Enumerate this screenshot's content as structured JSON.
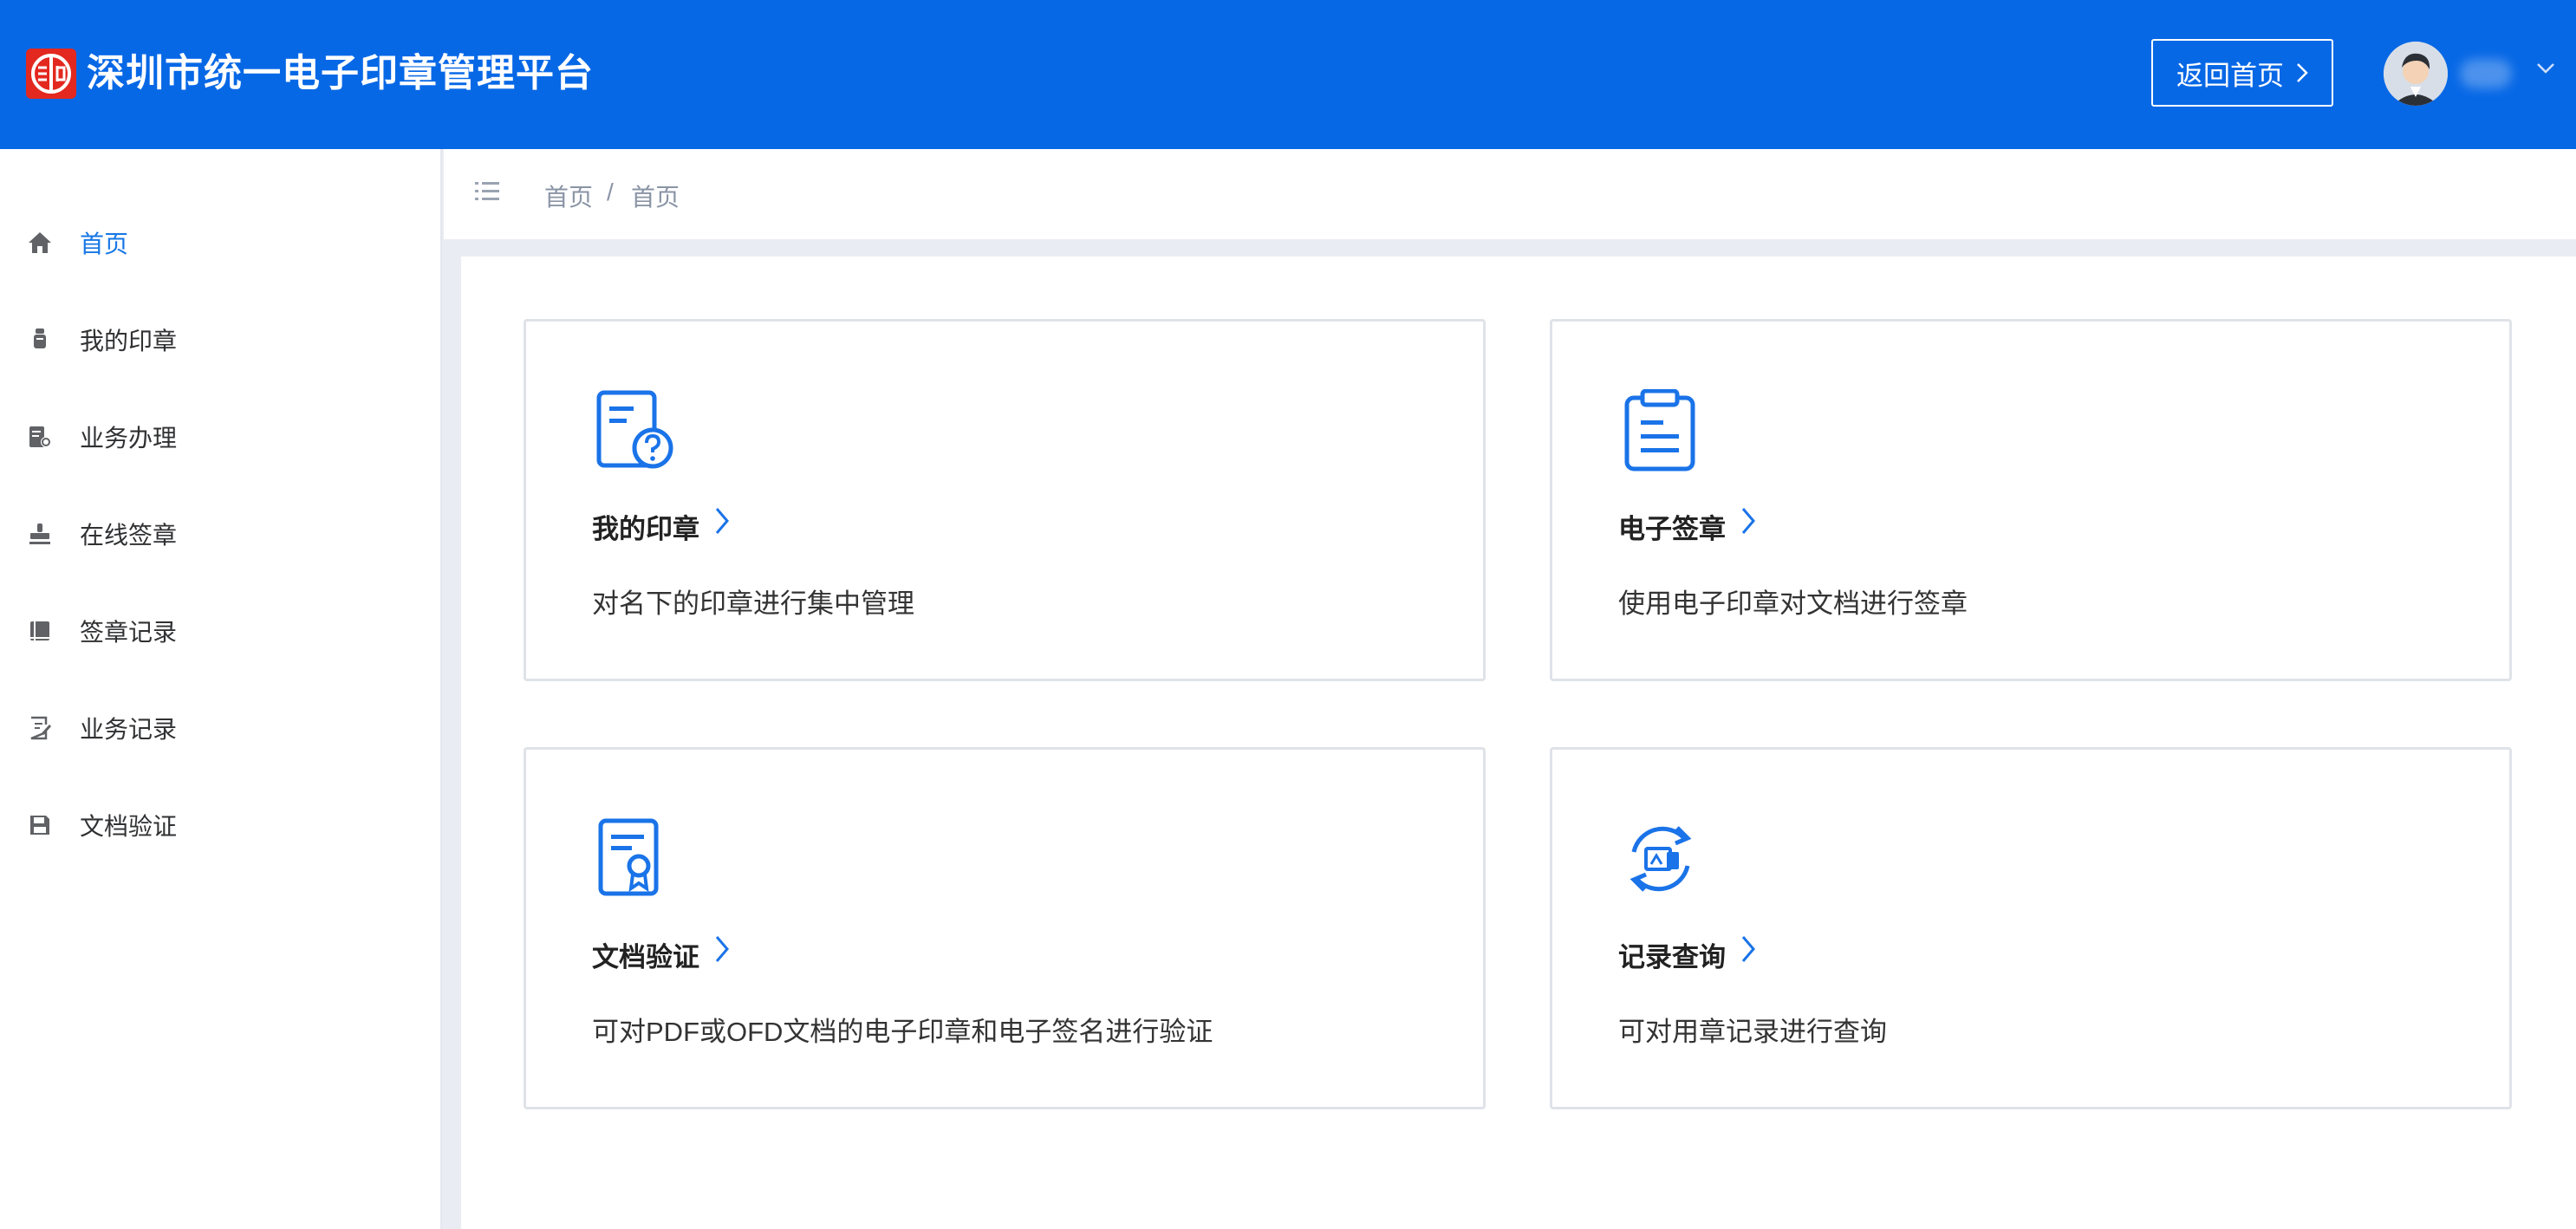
{
  "header": {
    "title": "深圳市统一电子印章管理平台",
    "back_home_label": "返回首页",
    "logo_icon": "seal-logo-icon",
    "brand_color": "#0768e6"
  },
  "sidebar": {
    "items": [
      {
        "label": "首页",
        "icon": "home-icon",
        "active": true
      },
      {
        "label": "我的印章",
        "icon": "seal-icon"
      },
      {
        "label": "业务办理",
        "icon": "document-settings-icon"
      },
      {
        "label": "在线签章",
        "icon": "stamp-icon"
      },
      {
        "label": "签章记录",
        "icon": "book-icon"
      },
      {
        "label": "业务记录",
        "icon": "edit-note-icon"
      },
      {
        "label": "文档验证",
        "icon": "save-icon"
      }
    ]
  },
  "breadcrumb": {
    "items": [
      "首页",
      "首页"
    ],
    "separator": "/"
  },
  "cards": [
    {
      "title": "我的印章",
      "description": "对名下的印章进行集中管理",
      "icon": "document-question-icon"
    },
    {
      "title": "电子签章",
      "description": "使用电子印章对文档进行签章",
      "icon": "clipboard-icon"
    },
    {
      "title": "文档验证",
      "description": "可对PDF或OFD文档的电子印章和电子签名进行验证",
      "icon": "certificate-icon"
    },
    {
      "title": "记录查询",
      "description": "可对用章记录进行查询",
      "icon": "refresh-record-icon"
    }
  ],
  "colors": {
    "accent": "#1677e6",
    "icon_blue": "#1a73e8"
  }
}
